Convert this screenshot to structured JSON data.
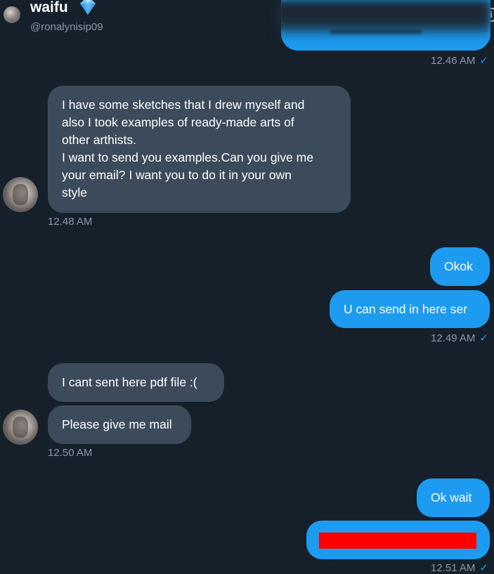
{
  "header": {
    "name": "waifu",
    "handle": "@ronalynisip09",
    "info_icon": "info-icon",
    "emoji_icon": "gem-icon"
  },
  "colors": {
    "background": "#15202b",
    "incoming_bubble": "#3c4b5b",
    "outgoing_bubble": "#1d9bf0",
    "timestamp": "#8b98a5",
    "redaction": "#ff0000"
  },
  "messages": {
    "m0_time": "12.46 AM",
    "m1": "I have some sketches that I drew myself and\nalso I took examples of ready-made arts of\nother arthists.\nI want to send you examples.Can you give me\nyour email? I want you to do it in your own\nstyle",
    "m1_time": "12.48 AM",
    "m2": "Okok",
    "m3": "U can send in here ser",
    "m3_time": "12.49 AM",
    "m4": "I cant sent here pdf file :(",
    "m5": "Please give me mail",
    "m5_time": "12.50 AM",
    "m6": "Ok wait",
    "m7_time": "12.51 AM"
  },
  "read_receipt": "✓"
}
